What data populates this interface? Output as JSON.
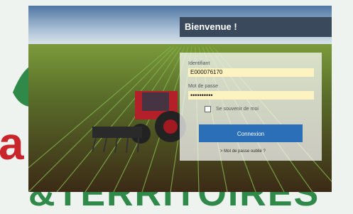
{
  "brand": {
    "line1": "a             s",
    "line2": "&TERRITOIRES"
  },
  "login": {
    "title": "Bienvenue !",
    "identifiant_label": "Identifiant",
    "identifiant_value": "E000076170",
    "password_label": "Mot de passe",
    "password_value": "••••••••••",
    "remember_label": "Se souvenir de moi",
    "remember_checked": false,
    "submit_label": "Connexion",
    "forgot_label": "> Mot de passe oublié ?"
  },
  "colors": {
    "header_bg": "#3a4a5c",
    "button_bg": "#2b6fb8",
    "field_bg": "#fdf3c0",
    "brand_red": "#c8262b",
    "brand_green": "#2f8a4a"
  }
}
